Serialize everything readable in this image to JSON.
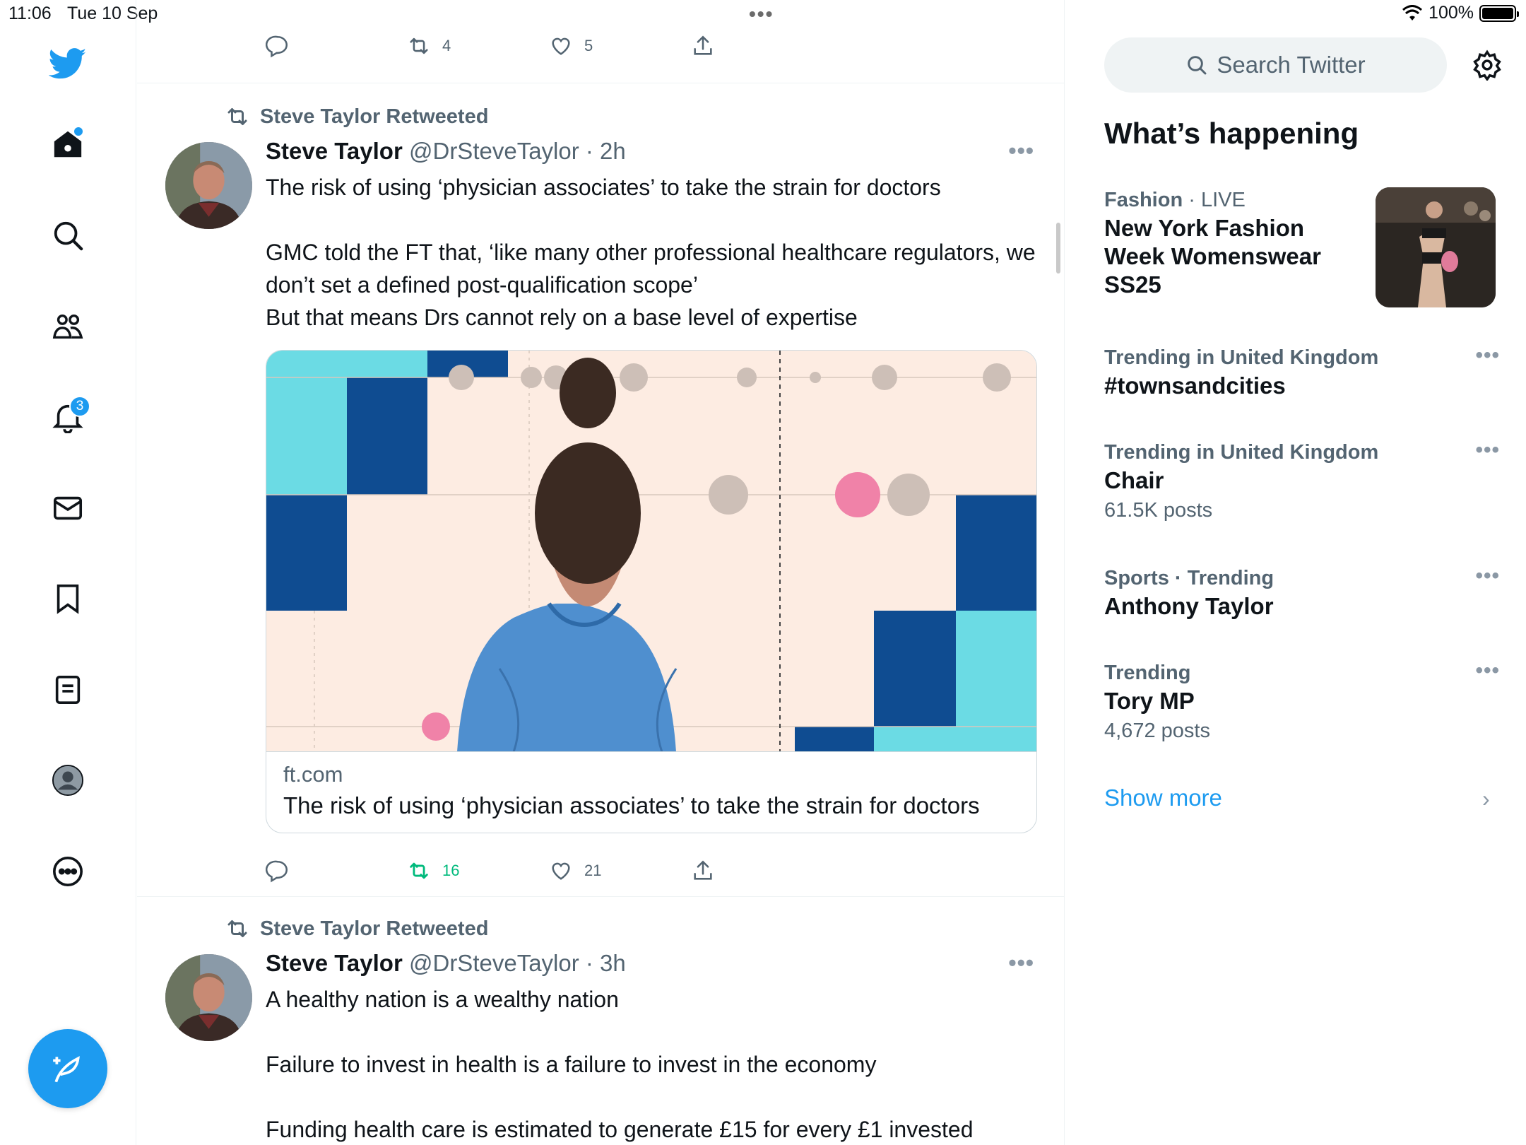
{
  "status_bar": {
    "time": "11:06",
    "date": "Tue 10 Sep",
    "battery": "100%"
  },
  "nav": {
    "notification_count": "3"
  },
  "top_tweet_actions": {
    "retweets": "4",
    "likes": "5"
  },
  "tweets": [
    {
      "retweeted_by": "Steve Taylor Retweeted",
      "name": "Steve Taylor",
      "handle": "@DrSteveTaylor",
      "time": "· 2h",
      "text_lines": [
        "The risk of using ‘physician associates’ to take the strain for doctors",
        "",
        "GMC told the FT that, ‘like many other professional healthcare regulators, we don’t set a defined post-qualification scope’",
        "But that means Drs cannot rely on a base level of expertise"
      ],
      "card": {
        "domain": "ft.com",
        "title": "The risk of using ‘physician associates’ to take the strain for doctors"
      },
      "retweets": "16",
      "likes": "21"
    },
    {
      "retweeted_by": "Steve Taylor Retweeted",
      "name": "Steve Taylor",
      "handle": "@DrSteveTaylor",
      "time": "· 3h",
      "text_lines": [
        "A healthy nation is a wealthy nation",
        "",
        "Failure to invest in health is a failure to invest in the economy",
        "",
        "Funding health care is estimated to generate £15 for every £1 invested"
      ]
    }
  ],
  "sidebar": {
    "search_placeholder": "Search Twitter",
    "title": "What’s happening",
    "trends": [
      {
        "category": "Fashion",
        "live": "· LIVE",
        "name": "New York Fashion Week Womenswear SS25"
      },
      {
        "category": "Trending in United Kingdom",
        "name": "#townsandcities"
      },
      {
        "category": "Trending in United Kingdom",
        "name": "Chair",
        "count": "61.5K posts"
      },
      {
        "category": "Sports · Trending",
        "name": "Anthony Taylor"
      },
      {
        "category": "Trending",
        "name": "Tory MP",
        "count": "4,672 posts"
      }
    ],
    "show_more": "Show more"
  },
  "colors": {
    "accent": "#1d9bf0",
    "retweet_green": "#00ba7c",
    "muted": "#536471"
  }
}
